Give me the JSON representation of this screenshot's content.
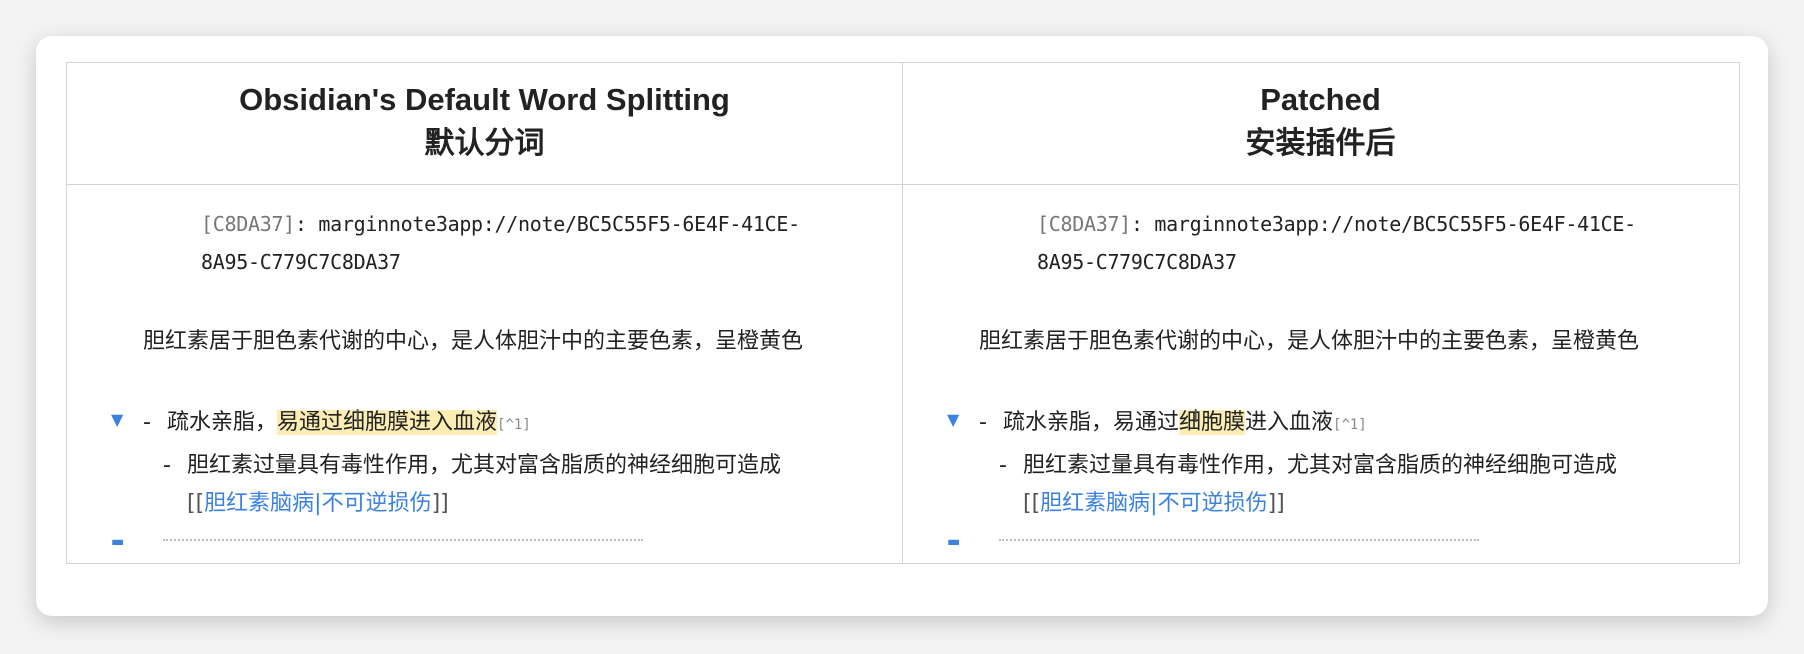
{
  "left": {
    "title_en": "Obsidian's Default Word Splitting",
    "title_zh": "默认分词",
    "ref_key": "[C8DA37]",
    "ref_sep": ": ",
    "ref_line1": "marginnote3app://note/BC5C55F5-6E4F-41CE-",
    "ref_line2": "8A95-C779C7C8DA37",
    "para": "胆红素居于胆色素代谢的中心，是人体胆汁中的主要色素，呈橙黄色",
    "arrow": "▼",
    "dash": "-",
    "bullet_pre": "疏水亲脂，",
    "bullet_hl": "易通过细胞膜进入血液",
    "bullet_post": "",
    "footnote": "[^1]",
    "sub_dash": "-",
    "sub_text": "胆红素过量具有毒性作用，尤其对富含脂质的神经细胞可造成",
    "link_open": "[[",
    "link_text": "胆红素脑病|不可逆损伤",
    "link_close": "]]",
    "cursor": "I"
  },
  "right": {
    "title_en": "Patched",
    "title_zh": "安装插件后",
    "ref_key": "[C8DA37]",
    "ref_sep": ": ",
    "ref_line1": "marginnote3app://note/BC5C55F5-6E4F-41CE-",
    "ref_line2": "8A95-C779C7C8DA37",
    "para": "胆红素居于胆色素代谢的中心，是人体胆汁中的主要色素，呈橙黄色",
    "arrow": "▼",
    "dash": "-",
    "bullet_pre": "疏水亲脂，易通过",
    "bullet_hl": "细胞膜",
    "bullet_post": "进入血液",
    "footnote": "[^1]",
    "sub_dash": "-",
    "sub_text": "胆红素过量具有毒性作用，尤其对富含脂质的神经细胞可造成",
    "link_open": "[[",
    "link_text": "胆红素脑病|不可逆损伤",
    "link_close": "]]",
    "cursor": "I"
  },
  "colors": {
    "highlight": "#fbedb4",
    "link": "#3b82e0",
    "border": "#d4d4d4"
  }
}
